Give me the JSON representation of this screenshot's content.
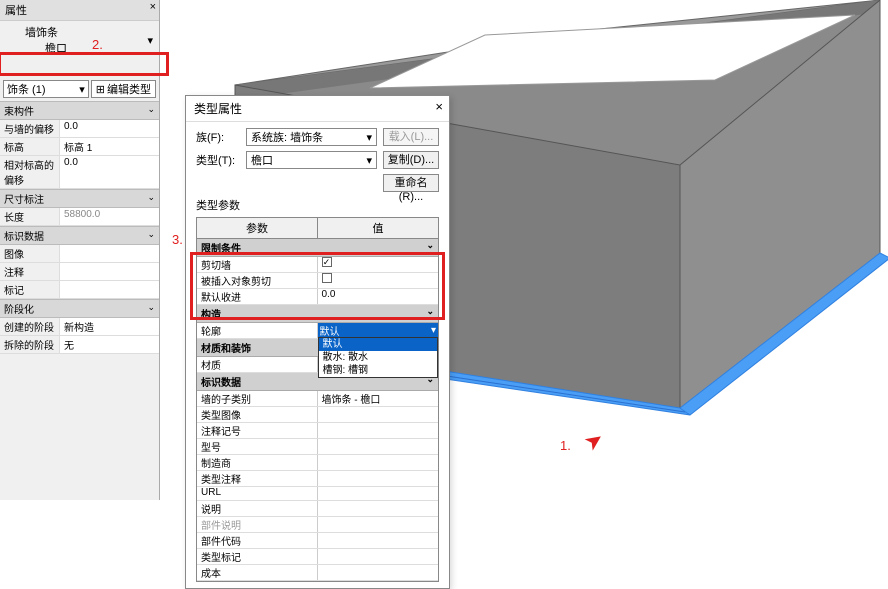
{
  "left_panel": {
    "title": "属性",
    "selector": {
      "line1": "墙饰条",
      "line2": "檐口"
    },
    "type_dropdown": "饰条 (1)",
    "edit_type": "编辑类型",
    "sections": {
      "constraints": "束构件",
      "offset_label": "与墙的偏移",
      "offset_value": "0.0",
      "level_label": "标高",
      "level_value": "标高 1",
      "rel_offset_label": "相对标高的偏移",
      "rel_offset_value": "0.0",
      "dim": "尺寸标注",
      "length_label": "长度",
      "length_value": "58800.0",
      "identity": "标识数据",
      "image_label": "图像",
      "comment_label": "注释",
      "mark_label": "标记",
      "phasing": "阶段化",
      "phase_created_label": "创建的阶段",
      "phase_created_value": "新构造",
      "phase_demo_label": "拆除的阶段",
      "phase_demo_value": "无"
    }
  },
  "dialog": {
    "title": "类型属性",
    "family_label": "族(F):",
    "family_value": "系统族: 墙饰条",
    "load_btn": "载入(L)...",
    "type_label": "类型(T):",
    "type_value": "檐口",
    "duplicate_btn": "复制(D)...",
    "rename_btn": "重命名(R)...",
    "params_label": "类型参数",
    "col_param": "参数",
    "col_value": "值",
    "cat_constraints": "限制条件",
    "cut_wall_label": "剪切墙",
    "cut_by_insert_label": "被插入对象剪切",
    "default_setback_label": "默认收进",
    "default_setback_value": "0.0",
    "cat_construction": "构造",
    "profile_label": "轮廓",
    "profile_value": "默认",
    "dropdown_options": [
      "默认",
      "散水: 散水",
      "槽钢: 槽钢"
    ],
    "cat_material": "材质和装饰",
    "material_label": "材质",
    "cat_identity": "标识数据",
    "subcategory_label": "墙的子类别",
    "subcategory_value": "墙饰条 - 檐口",
    "type_image_label": "类型图像",
    "keynote_label": "注释记号",
    "model_label": "型号",
    "manufacturer_label": "制造商",
    "type_comment_label": "类型注释",
    "url_label": "URL",
    "description_label": "说明",
    "section_desc_label": "部件说明",
    "assembly_code_label": "部件代码",
    "type_mark_label": "类型标记",
    "cost_label": "成本"
  },
  "annotations": {
    "a1": "1.",
    "a2": "2.",
    "a3": "3."
  }
}
